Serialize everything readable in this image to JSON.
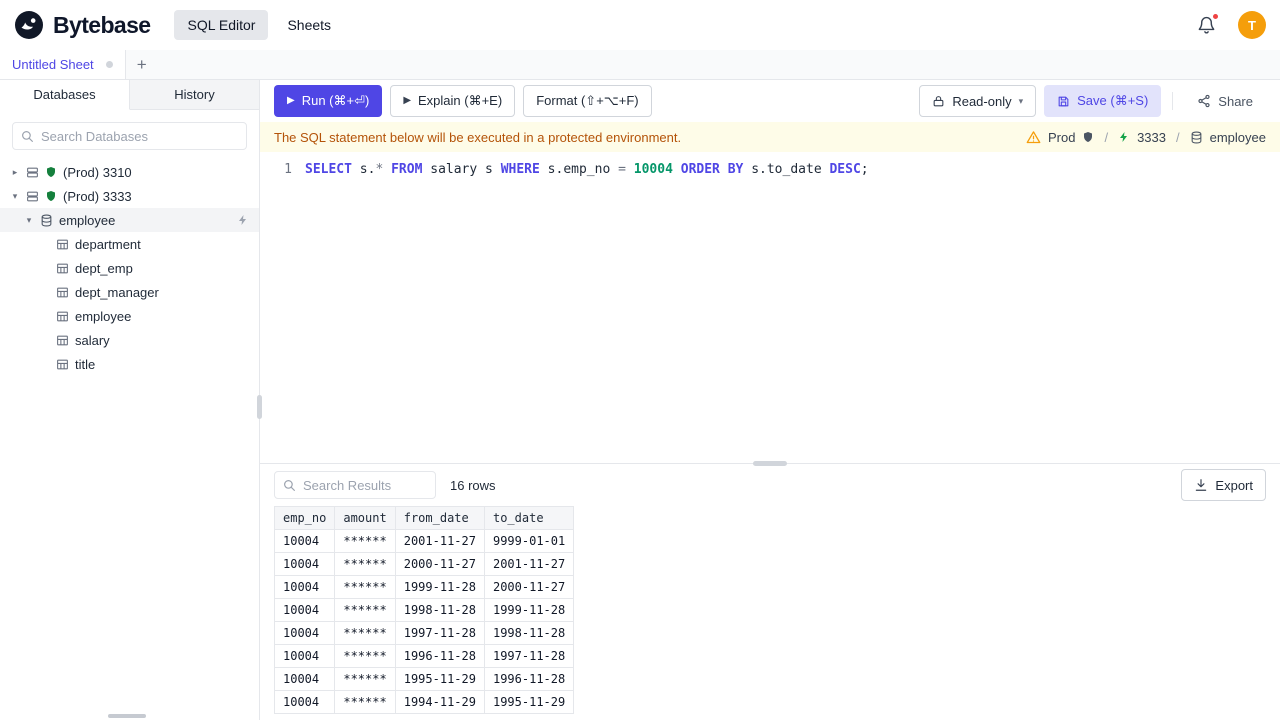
{
  "header": {
    "brand": "Bytebase",
    "nav": [
      {
        "label": "SQL Editor"
      },
      {
        "label": "Sheets"
      }
    ],
    "avatar": "T"
  },
  "sheet_bar": {
    "active_tab": "Untitled Sheet",
    "add_button": "+"
  },
  "sidebar": {
    "tabs": [
      {
        "label": "Databases"
      },
      {
        "label": "History"
      }
    ],
    "search_placeholder": "Search Databases",
    "tree": [
      {
        "label": "(Prod) 3310",
        "type": "instance",
        "level": 0,
        "expanded": false,
        "selected": false
      },
      {
        "label": "(Prod) 3333",
        "type": "instance",
        "level": 0,
        "expanded": true,
        "selected": false
      },
      {
        "label": "employee",
        "type": "database",
        "level": 1,
        "expanded": true,
        "selected": true
      },
      {
        "label": "department",
        "type": "table",
        "level": 2
      },
      {
        "label": "dept_emp",
        "type": "table",
        "level": 2
      },
      {
        "label": "dept_manager",
        "type": "table",
        "level": 2
      },
      {
        "label": "employee",
        "type": "table",
        "level": 2
      },
      {
        "label": "salary",
        "type": "table",
        "level": 2
      },
      {
        "label": "title",
        "type": "table",
        "level": 2
      }
    ]
  },
  "toolbar": {
    "run": "Run (⌘+⏎)",
    "explain": "Explain (⌘+E)",
    "format": "Format (⇧+⌥+F)",
    "readonly": "Read-only",
    "save": "Save (⌘+S)",
    "share": "Share"
  },
  "banner": {
    "message": "The SQL statement below will be executed in a protected environment.",
    "environment": "Prod",
    "instance": "3333",
    "database": "employee",
    "separator": "/"
  },
  "editor": {
    "line_number": "1",
    "sql": "SELECT s.* FROM salary s WHERE s.emp_no = 10004 ORDER BY s.to_date DESC;",
    "tokens": [
      {
        "text": "SELECT",
        "type": "kw"
      },
      {
        "text": " s.",
        "type": "plain"
      },
      {
        "text": "*",
        "type": "op"
      },
      {
        "text": " ",
        "type": "plain"
      },
      {
        "text": "FROM",
        "type": "kw"
      },
      {
        "text": " salary s ",
        "type": "plain"
      },
      {
        "text": "WHERE",
        "type": "kw"
      },
      {
        "text": " s.emp_no ",
        "type": "plain"
      },
      {
        "text": "=",
        "type": "op"
      },
      {
        "text": " ",
        "type": "plain"
      },
      {
        "text": "10004",
        "type": "num"
      },
      {
        "text": " ",
        "type": "plain"
      },
      {
        "text": "ORDER BY",
        "type": "kw"
      },
      {
        "text": " s.to_date ",
        "type": "plain"
      },
      {
        "text": "DESC",
        "type": "kw"
      },
      {
        "text": ";",
        "type": "plain"
      }
    ]
  },
  "results": {
    "search_placeholder": "Search Results",
    "row_count": "16 rows",
    "export": "Export",
    "columns": [
      "emp_no",
      "amount",
      "from_date",
      "to_date"
    ],
    "rows": [
      [
        "10004",
        "******",
        "2001-11-27",
        "9999-01-01"
      ],
      [
        "10004",
        "******",
        "2000-11-27",
        "2001-11-27"
      ],
      [
        "10004",
        "******",
        "1999-11-28",
        "2000-11-27"
      ],
      [
        "10004",
        "******",
        "1998-11-28",
        "1999-11-28"
      ],
      [
        "10004",
        "******",
        "1997-11-28",
        "1998-11-28"
      ],
      [
        "10004",
        "******",
        "1996-11-28",
        "1997-11-28"
      ],
      [
        "10004",
        "******",
        "1995-11-29",
        "1996-11-28"
      ],
      [
        "10004",
        "******",
        "1994-11-29",
        "1995-11-29"
      ]
    ]
  },
  "colors": {
    "primary": "#4f46e5",
    "warning_bg": "#fefce8",
    "warning_text": "#b45309",
    "keyword": "#4f46e5",
    "number": "#059669",
    "avatar_bg": "#f59e0b",
    "notification_dot": "#ef4444"
  }
}
